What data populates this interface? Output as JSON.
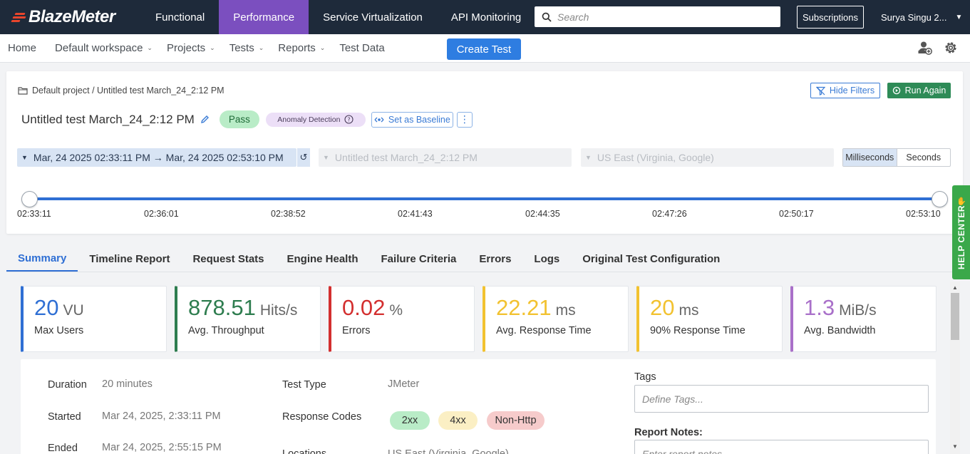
{
  "topnav": {
    "logo": "BlazeMeter",
    "tabs": [
      {
        "label": "Functional",
        "active": false
      },
      {
        "label": "Performance",
        "active": true
      },
      {
        "label": "Service Virtualization",
        "active": false
      },
      {
        "label": "API Monitoring",
        "active": false
      }
    ],
    "search_placeholder": "Search",
    "subscriptions_label": "Subscriptions",
    "user_name": "Surya Singu 2...",
    "accent_color": "#7b4fbf"
  },
  "subnav": {
    "items": [
      {
        "label": "Home",
        "dropdown": false
      },
      {
        "label": "Default workspace",
        "dropdown": true
      },
      {
        "label": "Projects",
        "dropdown": true
      },
      {
        "label": "Tests",
        "dropdown": true
      },
      {
        "label": "Reports",
        "dropdown": true
      },
      {
        "label": "Test Data",
        "dropdown": false
      }
    ],
    "create_label": "Create Test"
  },
  "report": {
    "breadcrumb": "Default project / Untitled test March_24_2:12 PM",
    "hide_filters_label": "Hide Filters",
    "run_again_label": "Run Again",
    "title": "Untitled test March_24_2:12 PM",
    "status": "Pass",
    "anomaly_label": "Anomaly Detection",
    "baseline_label": "Set as Baseline",
    "kebab": "⋮",
    "range_label": "Mar, 24 2025 02:33:11 PM → Mar, 24 2025 02:53:10 PM",
    "test_select": "Untitled test March_24_2:12 PM",
    "location_select": "US East (Virginia, Google)",
    "units": [
      {
        "label": "Milliseconds",
        "active": true
      },
      {
        "label": "Seconds",
        "active": false
      }
    ],
    "ticks": [
      "02:33:11",
      "02:36:01",
      "02:38:52",
      "02:41:43",
      "02:44:35",
      "02:47:26",
      "02:50:17",
      "02:53:10"
    ]
  },
  "tabs": [
    {
      "label": "Summary",
      "active": true
    },
    {
      "label": "Timeline Report",
      "active": false
    },
    {
      "label": "Request Stats",
      "active": false
    },
    {
      "label": "Engine Health",
      "active": false
    },
    {
      "label": "Failure Criteria",
      "active": false
    },
    {
      "label": "Errors",
      "active": false
    },
    {
      "label": "Logs",
      "active": false
    },
    {
      "label": "Original Test Configuration",
      "active": false
    }
  ],
  "metrics": [
    {
      "value": "20",
      "unit": "VU",
      "label": "Max Users",
      "color": "#2f6fd4"
    },
    {
      "value": "878.51",
      "unit": "Hits/s",
      "label": "Avg. Throughput",
      "color": "#2e7d4f"
    },
    {
      "value": "0.02",
      "unit": "%",
      "label": "Errors",
      "color": "#d32f2f"
    },
    {
      "value": "22.21",
      "unit": "ms",
      "label": "Avg. Response Time",
      "color": "#f2c230"
    },
    {
      "value": "20",
      "unit": "ms",
      "label": "90% Response Time",
      "color": "#f2c230"
    },
    {
      "value": "1.3",
      "unit": "MiB/s",
      "label": "Avg. Bandwidth",
      "color": "#a970c9"
    }
  ],
  "details": {
    "duration_label": "Duration",
    "duration": "20 minutes",
    "started_label": "Started",
    "started": "Mar 24, 2025, 2:33:11 PM",
    "ended_label": "Ended",
    "ended": "Mar 24, 2025, 2:55:15 PM",
    "test_type_label": "Test Type",
    "test_type": "JMeter",
    "response_codes_label": "Response Codes",
    "codes": [
      {
        "label": "2xx",
        "color": "#b9ecc7"
      },
      {
        "label": "4xx",
        "color": "#fbefc4"
      },
      {
        "label": "Non-Http",
        "color": "#f6cbcb"
      }
    ],
    "location_label": "Locations",
    "location": "US East (Virginia, Google)",
    "tags_label": "Tags",
    "tags_placeholder": "Define Tags...",
    "notes_label": "Report Notes:",
    "notes_placeholder": "Enter report notes..."
  },
  "help_center": "HELP CENTER"
}
